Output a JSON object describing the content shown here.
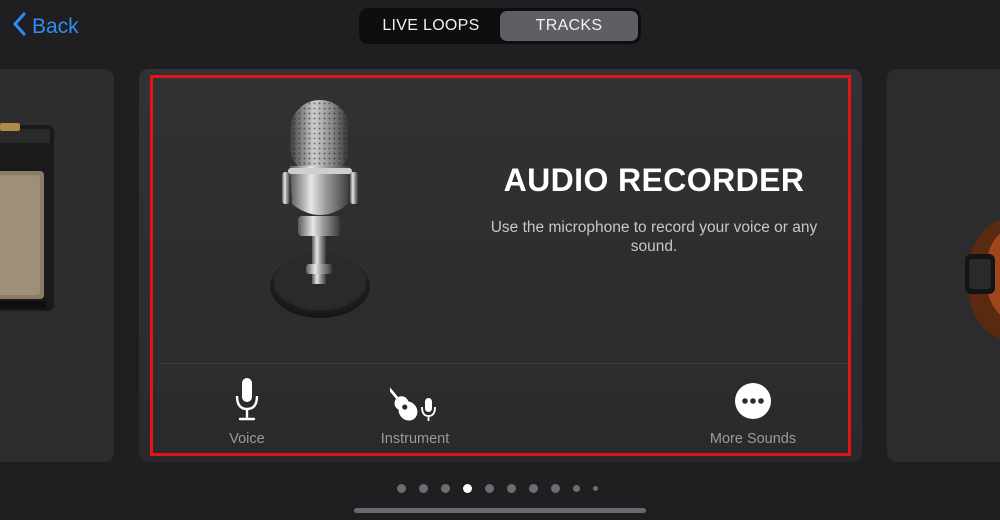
{
  "nav": {
    "back_label": "Back"
  },
  "segmented": {
    "items": [
      "LIVE LOOPS",
      "TRACKS"
    ],
    "selected": "TRACKS"
  },
  "card": {
    "title": "AUDIO RECORDER",
    "description": "Use the microphone to record your voice or any sound.",
    "options": [
      {
        "label": "Voice",
        "icon": "microphone-icon"
      },
      {
        "label": "Instrument",
        "icon": "guitar-with-mic-icon"
      },
      {
        "label": "More Sounds",
        "icon": "more-ellipsis-icon"
      }
    ]
  },
  "pager": {
    "total": 10,
    "current_index": 3
  },
  "colors": {
    "accent": "#2f8cf6",
    "highlight": "#e41414",
    "background": "#1f1f21"
  }
}
